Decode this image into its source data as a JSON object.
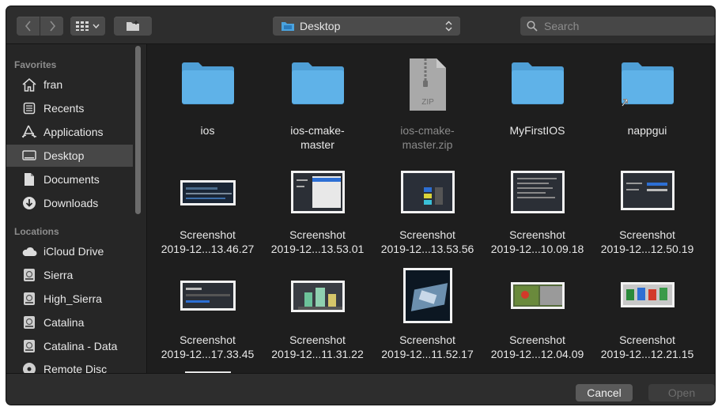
{
  "toolbar": {
    "location": "Desktop",
    "search_placeholder": "Search"
  },
  "sidebar": {
    "favorites_header": "Favorites",
    "favorites": [
      {
        "label": "fran",
        "icon": "home-icon"
      },
      {
        "label": "Recents",
        "icon": "recents-icon"
      },
      {
        "label": "Applications",
        "icon": "applications-icon"
      },
      {
        "label": "Desktop",
        "icon": "desktop-icon",
        "selected": true
      },
      {
        "label": "Documents",
        "icon": "documents-icon"
      },
      {
        "label": "Downloads",
        "icon": "downloads-icon"
      }
    ],
    "locations_header": "Locations",
    "locations": [
      {
        "label": "iCloud Drive",
        "icon": "cloud-icon"
      },
      {
        "label": "Sierra",
        "icon": "disk-icon"
      },
      {
        "label": "High_Sierra",
        "icon": "disk-icon"
      },
      {
        "label": "Catalina",
        "icon": "disk-icon"
      },
      {
        "label": "Catalina - Data",
        "icon": "disk-icon"
      },
      {
        "label": "Remote Disc",
        "icon": "disc-icon"
      }
    ]
  },
  "files": [
    {
      "line1": "ios",
      "line2": "",
      "kind": "folder"
    },
    {
      "line1": "ios-cmake-",
      "line2": "master",
      "kind": "folder"
    },
    {
      "line1": "ios-cmake-",
      "line2": "master.zip",
      "kind": "zip",
      "zip_label": "ZIP"
    },
    {
      "line1": "MyFirstIOS",
      "line2": "",
      "kind": "folder"
    },
    {
      "line1": "nappgui",
      "line2": "",
      "kind": "folder"
    },
    {
      "line1": "Screenshot",
      "line2": "2019-12...13.46.27",
      "kind": "shot"
    },
    {
      "line1": "Screenshot",
      "line2": "2019-12...13.53.01",
      "kind": "shot"
    },
    {
      "line1": "Screenshot",
      "line2": "2019-12...13.53.56",
      "kind": "shot"
    },
    {
      "line1": "Screenshot",
      "line2": "2019-12...10.09.18",
      "kind": "shot"
    },
    {
      "line1": "Screenshot",
      "line2": "2019-12...12.50.19",
      "kind": "shot"
    },
    {
      "line1": "Screenshot",
      "line2": "2019-12...17.33.45",
      "kind": "shot"
    },
    {
      "line1": "Screenshot",
      "line2": "2019-12...11.31.22",
      "kind": "shot"
    },
    {
      "line1": "Screenshot",
      "line2": "2019-12...11.52.17",
      "kind": "shot"
    },
    {
      "line1": "Screenshot",
      "line2": "2019-12...12.04.09",
      "kind": "shot"
    },
    {
      "line1": "Screenshot",
      "line2": "2019-12...12.21.15",
      "kind": "shot"
    }
  ],
  "buttons": {
    "cancel": "Cancel",
    "open": "Open"
  },
  "colors": {
    "folder": "#5aaee6",
    "accent": "#1d6fdc"
  }
}
